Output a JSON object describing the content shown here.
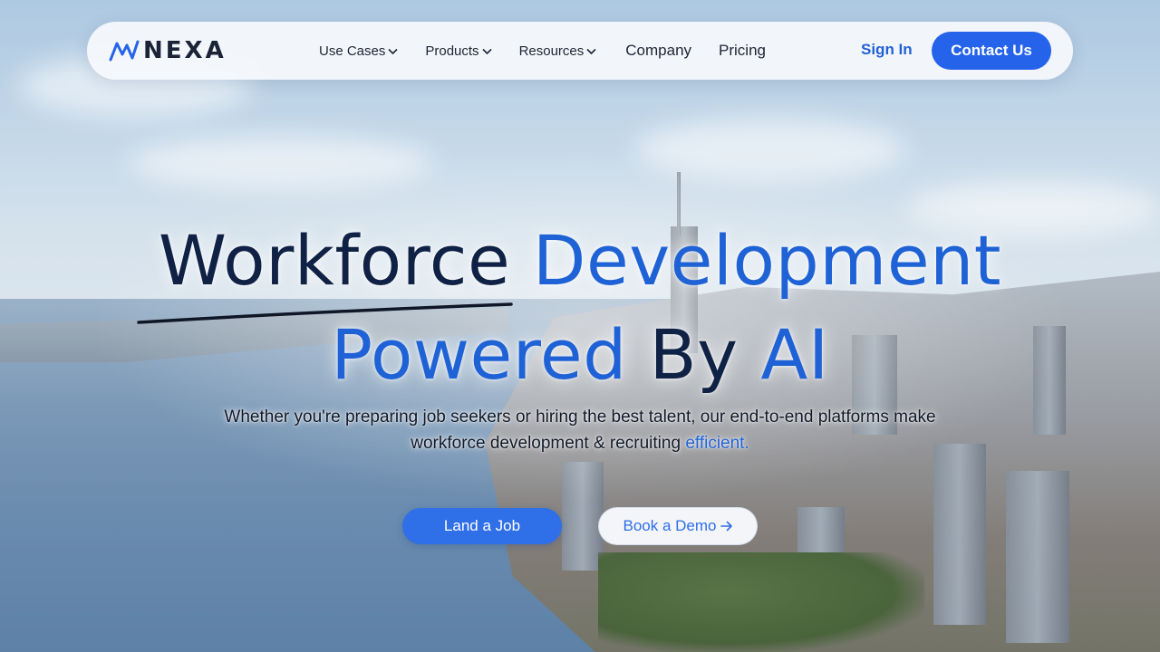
{
  "brand": {
    "name": "NEXA",
    "logo_icon": "nexa-wave-logo-icon",
    "colors": {
      "primary": "#2563eb",
      "dark_text": "#0f2144",
      "accent_text": "#1f62d6"
    }
  },
  "nav": {
    "items": [
      {
        "label": "Use Cases",
        "has_dropdown": true,
        "icon": "chevron-down-icon"
      },
      {
        "label": "Products",
        "has_dropdown": true,
        "icon": "chevron-down-icon"
      },
      {
        "label": "Resources",
        "has_dropdown": true,
        "icon": "chevron-down-icon"
      },
      {
        "label": "Company",
        "has_dropdown": false
      },
      {
        "label": "Pricing",
        "has_dropdown": false
      }
    ],
    "sign_in_label": "Sign In",
    "contact_label": "Contact Us"
  },
  "hero": {
    "headline": {
      "line1_dark": "Workforce",
      "line1_blue": "Development",
      "line2_blue": "Powered",
      "line2_dark": "By",
      "line2_blue_end": "AI"
    },
    "subtitle": {
      "line1": "Whether you're preparing job seekers or hiring the best talent, our end-to-end platforms make",
      "line2": "workforce development & recruiting",
      "accent": "efficient."
    },
    "primary_cta": "Land a Job",
    "secondary_cta": "Book a Demo",
    "secondary_cta_icon": "arrow-right-icon",
    "background_image": "aerial-city-skyline-photo"
  }
}
